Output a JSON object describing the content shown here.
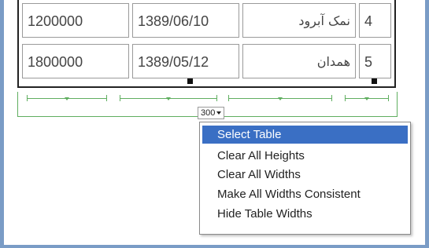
{
  "table": {
    "rows": [
      {
        "amount": "1200000",
        "date": "1389/06/10",
        "city": "نمک آبرود",
        "id": "4"
      },
      {
        "amount": "1800000",
        "date": "1389/05/12",
        "city": "همدان",
        "id": "5"
      }
    ]
  },
  "width_indicator": {
    "value": "300"
  },
  "context_menu": {
    "items": [
      {
        "label": "Select Table",
        "selected": true
      },
      {
        "label": "Clear All Heights"
      },
      {
        "label": "Clear All Widths"
      },
      {
        "label": "Make All Widths Consistent"
      },
      {
        "label": "Hide Table Widths"
      }
    ]
  },
  "colors": {
    "frame": "#7a9cc6",
    "width_guides": "#5fae5f",
    "menu_highlight": "#3a6fc4"
  }
}
